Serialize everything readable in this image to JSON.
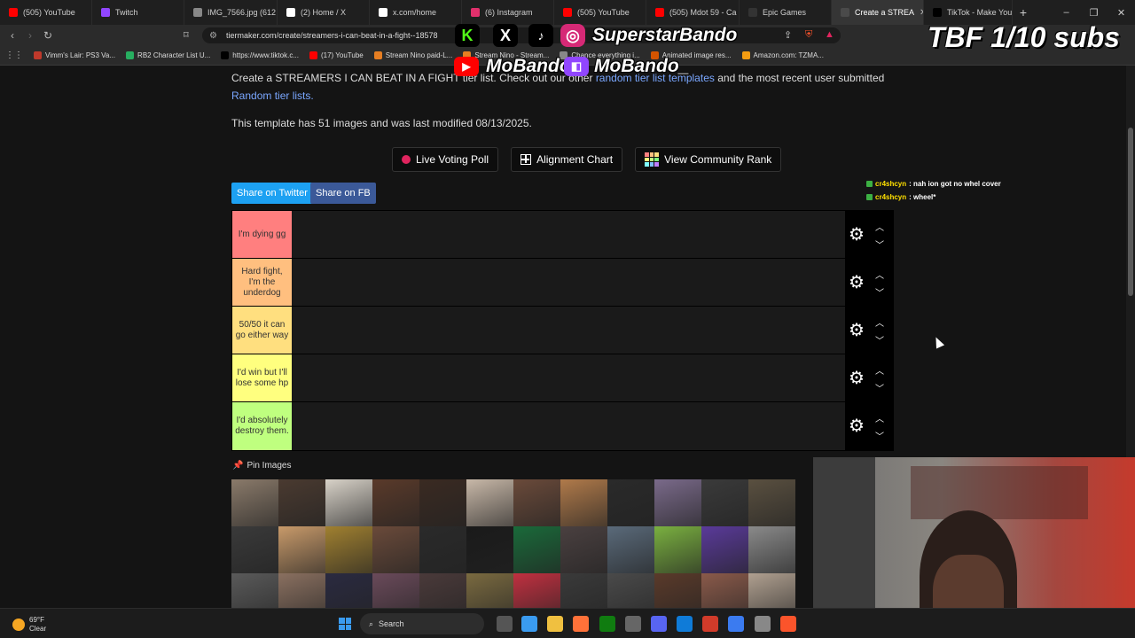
{
  "browser": {
    "tabs": [
      {
        "label": "(505) YouTube",
        "color": "#ff0000"
      },
      {
        "label": "Twitch",
        "color": "#9146ff"
      },
      {
        "label": "IMG_7566.jpg (612",
        "color": "#888888"
      },
      {
        "label": "(2) Home / X",
        "color": "#ffffff"
      },
      {
        "label": "x.com/home",
        "color": "#ffffff"
      },
      {
        "label": "(6) Instagram",
        "color": "#e1306c"
      },
      {
        "label": "(505) YouTube",
        "color": "#ff0000"
      },
      {
        "label": "(505) Mdot 59 - Ca",
        "color": "#ff0000"
      },
      {
        "label": "Epic Games",
        "color": "#333333"
      },
      {
        "label": "Create a STREA",
        "color": "#4a4a4a"
      },
      {
        "label": "TikTok - Make Your",
        "color": "#000000"
      }
    ],
    "active_tab": 9,
    "new_tab": "+",
    "url": "tiermaker.com/create/streamers-i-can-beat-in-a-fight--18578",
    "bookmarks": [
      {
        "label": "Vimm's Lair: PS3 Va...",
        "color": "#c0392b"
      },
      {
        "label": "RB2 Character List U...",
        "color": "#27ae60"
      },
      {
        "label": "https://www.tiktok.c...",
        "color": "#000000"
      },
      {
        "label": "(17) YouTube",
        "color": "#ff0000"
      },
      {
        "label": "Stream Nino paid-L...",
        "color": "#e67e22"
      },
      {
        "label": "Stream Nino - Stream...",
        "color": "#e67e22"
      },
      {
        "label": "Chance everything i...",
        "color": "#888888"
      },
      {
        "label": "Animated image res...",
        "color": "#d35400"
      },
      {
        "label": "Amazon.com: TZMA...",
        "color": "#f39c12"
      }
    ]
  },
  "page": {
    "intro_text": "Create a STREAMERS I CAN BEAT IN A FIGHT tier list. Check out our other",
    "intro_link1": "random tier list templates",
    "intro_mid": "and the most recent user submitted",
    "intro_link2": "Random tier lists.",
    "meta": "This template has 51 images and was last modified 08/13/2025.",
    "buttons": {
      "live_voting": "Live Voting Poll",
      "alignment": "Alignment Chart",
      "community": "View Community Rank"
    },
    "share_twitter": "Share on Twitter",
    "share_fb": "Share on FB",
    "tiers": [
      {
        "label": "I'm dying gg",
        "color": "#ff7f7f"
      },
      {
        "label": "Hard fight, I'm the underdog",
        "color": "#ffbf7f"
      },
      {
        "label": "50/50 it can go either way",
        "color": "#ffdf7f"
      },
      {
        "label": "I'd win but I'll lose some hp",
        "color": "#ffff7f"
      },
      {
        "label": "I'd absolutely destroy them.",
        "color": "#bfff7f"
      }
    ],
    "pin_label": "Pin Images"
  },
  "chat": [
    {
      "user": "cr4shcyn",
      "msg": ": nah ion got no whel cover"
    },
    {
      "user": "cr4shcyn",
      "msg": ": wheel*"
    }
  ],
  "overlay": {
    "socials_handle_top": "SuperstarBando",
    "socials_handle_bottom1": "MoBando",
    "socials_handle_bottom2": "MoBando_",
    "tiktok_label": "TikTok",
    "subs": "TBF 1/10 subs"
  },
  "taskbar": {
    "temp": "69°F",
    "cond": "Clear",
    "search": "Search"
  }
}
